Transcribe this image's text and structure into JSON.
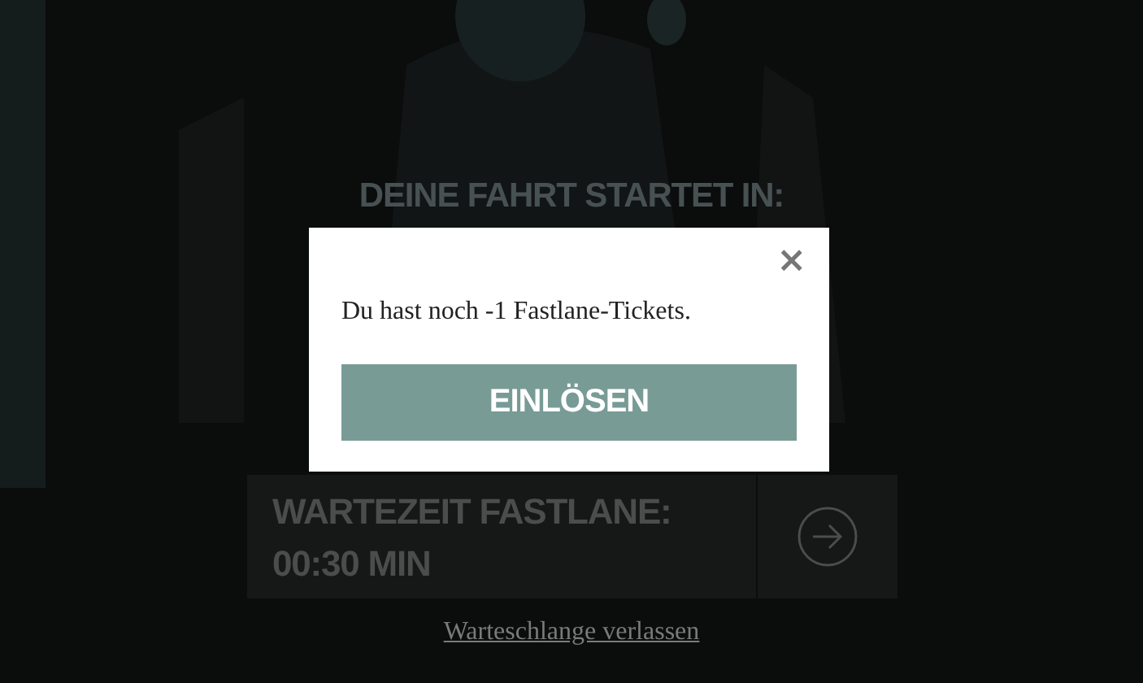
{
  "heading": "DEINE FAHRT STARTET IN:",
  "wait_card": {
    "title": "WARTEZEIT FASTLANE:",
    "value": "00:30 MIN"
  },
  "leave_link": "Warteschlange verlassen",
  "dialog": {
    "close": "×",
    "message": "Du hast noch -1 Fastlane-Tickets.",
    "button": "EINLÖSEN"
  }
}
